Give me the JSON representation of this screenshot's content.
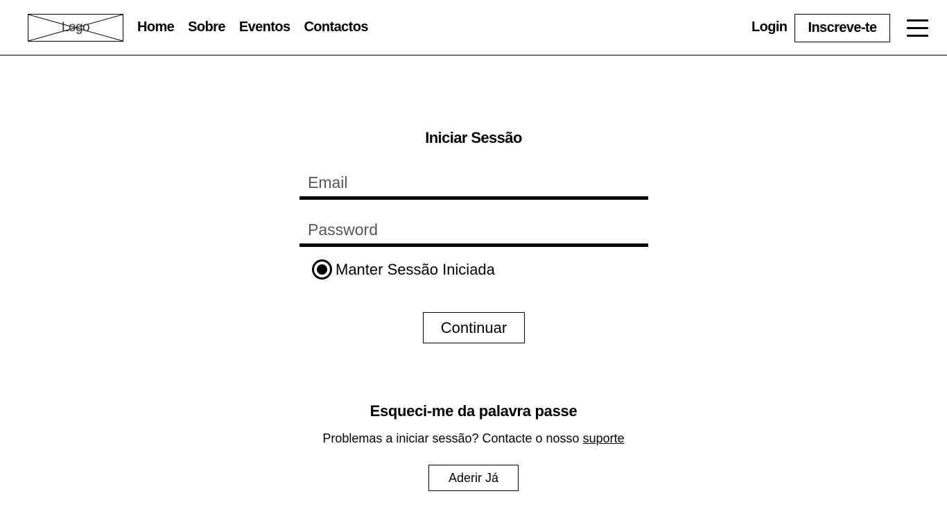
{
  "header": {
    "logo_text": "Logo",
    "nav": [
      "Home",
      "Sobre",
      "Eventos",
      "Contactos"
    ],
    "login_label": "Login",
    "signup_label": "Inscreve-te",
    "menu_icon": "hamburger-menu-icon"
  },
  "login": {
    "title": "Iniciar Sessão",
    "email_placeholder": "Email",
    "password_placeholder": "Password",
    "remember_label": "Manter Sessão Iniciada",
    "remember_checked": true,
    "continue_label": "Continuar"
  },
  "recovery": {
    "title": "Esqueci-me da palavra passe",
    "text": "Problemas a iniciar sessão? Contacte o nosso",
    "link": "suporte",
    "join_label": "Aderir Já"
  }
}
